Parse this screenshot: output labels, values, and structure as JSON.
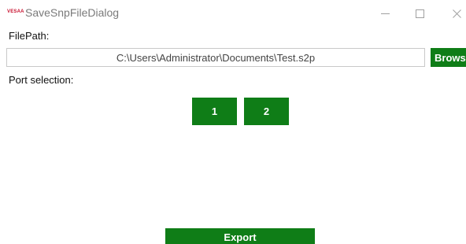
{
  "window": {
    "logo_text": "VESAA",
    "title": "SaveSnpFileDialog"
  },
  "filepath": {
    "label": "FilePath:",
    "value": "C:\\Users\\Administrator\\Documents\\Test.s2p",
    "browse_label": "Browse"
  },
  "ports": {
    "label": "Port selection:",
    "buttons": [
      "1",
      "2"
    ]
  },
  "footer": {
    "export_label": "Export"
  },
  "colors": {
    "accent": "#0f7d17",
    "logo": "#c8102e"
  },
  "icons": {
    "minimize": "minimize-icon",
    "maximize": "maximize-icon",
    "close": "close-icon"
  }
}
